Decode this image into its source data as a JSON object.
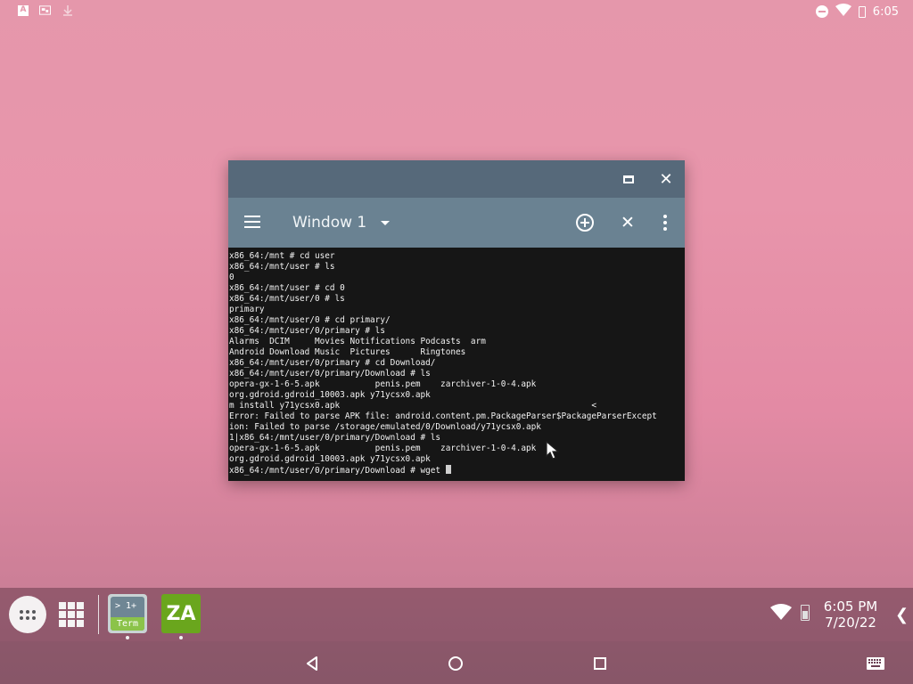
{
  "status_bar": {
    "time": "6:05",
    "left_icons": [
      "a-badge-icon",
      "screenshot-icon",
      "download-icon"
    ],
    "right_icons": [
      "do-not-disturb-icon",
      "wifi-icon",
      "battery-icon"
    ]
  },
  "window": {
    "caption_buttons": [
      "maximize-icon",
      "close-icon"
    ],
    "toolbar": {
      "tab_label": "Window 1",
      "icons": [
        "menu-icon",
        "add-circle-icon",
        "close-icon",
        "more-vert-icon"
      ]
    },
    "terminal": {
      "lines": [
        "x86_64:/mnt # cd user",
        "x86_64:/mnt/user # ls",
        "0",
        "x86_64:/mnt/user # cd 0",
        "x86_64:/mnt/user/0 # ls",
        "primary",
        "x86_64:/mnt/user/0 # cd primary/",
        "x86_64:/mnt/user/0/primary # ls",
        "Alarms  DCIM     Movies Notifications Podcasts  arm",
        "Android Download Music  Pictures      Ringtones",
        "x86_64:/mnt/user/0/primary # cd Download/",
        "x86_64:/mnt/user/0/primary/Download # ls",
        "opera-gx-1-6-5.apk           penis.pem    zarchiver-1-0-4.apk",
        "org.gdroid.gdroid_10003.apk y71ycsx0.apk",
        "m install y71ycsx0.apk                                                  <",
        "Error: Failed to parse APK file: android.content.pm.PackageParser$PackageParserExcept",
        "ion: Failed to parse /storage/emulated/0/Download/y71ycsx0.apk",
        "1|x86_64:/mnt/user/0/primary/Download # ls",
        "opera-gx-1-6-5.apk           penis.pem    zarchiver-1-0-4.apk",
        "org.gdroid.gdroid_10003.apk y71ycsx0.apk"
      ],
      "prompt": "x86_64:/mnt/user/0/primary/Download # wget "
    }
  },
  "taskbar": {
    "apps": [
      {
        "name": "Termux terminal",
        "icon_text_top": "> 1+",
        "icon_text_bottom": "Term"
      },
      {
        "name": "ZArchiver",
        "icon_text": "ZA"
      }
    ],
    "clock_time": "6:05 PM",
    "clock_date": "7/20/22",
    "tray_icons": [
      "wifi-icon",
      "battery-icon"
    ]
  },
  "navbar": {
    "buttons": [
      "back-icon",
      "home-icon",
      "recents-icon",
      "keyboard-icon"
    ]
  },
  "colors": {
    "caption": "#56697a",
    "toolbar": "#6a8292",
    "terminal_bg": "#161616",
    "zarchiver_green": "#6aa61d"
  }
}
